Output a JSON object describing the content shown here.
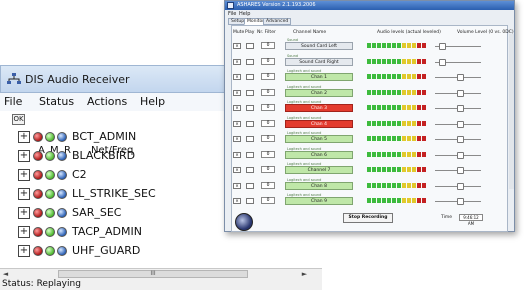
{
  "dis_window": {
    "title": "DIS Audio Receiver",
    "menu": [
      "File",
      "Status",
      "Actions",
      "Help"
    ],
    "toolbar_button": "OK",
    "columns": {
      "a": "A",
      "m": "M",
      "r": "R",
      "netfreq": "Net/Freq"
    },
    "nets": [
      "BCT_ADMIN",
      "BLACKBIRD",
      "C2",
      "LL_STRIKE_SEC",
      "SAR_SEC",
      "TACP_ADMIN",
      "UHF_GUARD"
    ],
    "expander_glyph": "+",
    "scroll": {
      "left": "◄",
      "right": "►",
      "thumb": "III"
    },
    "status": "Status: Replaying"
  },
  "recorder_window": {
    "title": "ASHARES Version 2.1.193.2006",
    "menu": [
      "File",
      "Help"
    ],
    "tabs": [
      "Setup",
      "Monitor",
      "Advanced"
    ],
    "active_tab": "Monitor",
    "headers": {
      "mute": "Mute",
      "play": "Play",
      "nr": "Nr. Filter",
      "channel": "Channel Name",
      "audio": "Audio levels (actual leveled)",
      "volume": "Volume Level (0 vs. 0DC)"
    },
    "channels": [
      {
        "num": "0",
        "sub": "Sound",
        "name": "Sound Card Left",
        "state": "neutral",
        "volume": 0.1
      },
      {
        "num": "0",
        "sub": "Sound",
        "name": "Sound Card Right",
        "state": "neutral",
        "volume": 0.1
      },
      {
        "num": "0",
        "sub": "Logitech and sound",
        "name": "Chan 1",
        "state": "normal",
        "volume": 0.55
      },
      {
        "num": "0",
        "sub": "Logitech and sound",
        "name": "Chan 2",
        "state": "normal",
        "volume": 0.55
      },
      {
        "num": "0",
        "sub": "Logitech and sound",
        "name": "Chan 3",
        "state": "alert",
        "volume": 0.55
      },
      {
        "num": "0",
        "sub": "Logitech and sound",
        "name": "Chan 4",
        "state": "alert",
        "volume": 0.55
      },
      {
        "num": "0",
        "sub": "Logitech and sound",
        "name": "Chan 5",
        "state": "normal",
        "volume": 0.55
      },
      {
        "num": "0",
        "sub": "Logitech and sound",
        "name": "Chan 6",
        "state": "normal",
        "volume": 0.55
      },
      {
        "num": "0",
        "sub": "Logitech and sound",
        "name": "Channel 7",
        "state": "normal",
        "volume": 0.55
      },
      {
        "num": "0",
        "sub": "Logitech and sound",
        "name": "Chan 8",
        "state": "normal",
        "volume": 0.55
      },
      {
        "num": "0",
        "sub": "Logitech and sound",
        "name": "Chan 9",
        "state": "normal",
        "volume": 0.55
      }
    ],
    "stop_button": "Stop Recording",
    "time_label": "Time",
    "time_value": "9:46:12 AM"
  },
  "colors": {
    "led_red": "#b01616",
    "led_green": "#4cb82c",
    "led_blue": "#2a5fb5",
    "channel_green": "#bfe7a8",
    "channel_alert": "#e33b2e",
    "meter_green": "#3dbb3d",
    "meter_yellow": "#e1c92b",
    "meter_red": "#c42121"
  }
}
